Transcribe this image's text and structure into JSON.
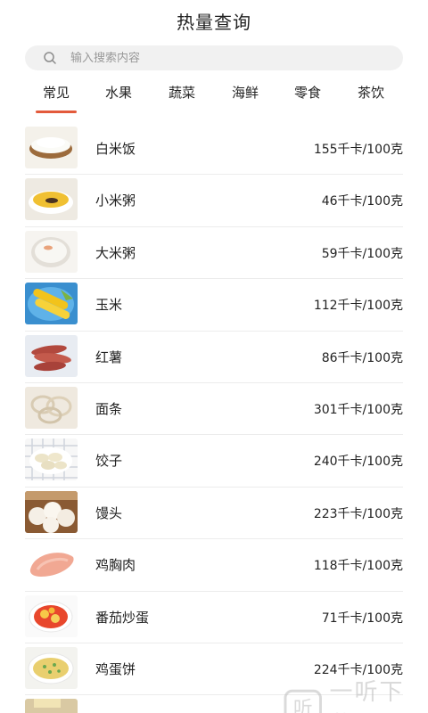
{
  "header": {
    "title": "热量查询"
  },
  "search": {
    "placeholder": "输入搜索内容",
    "value": ""
  },
  "tabs": [
    {
      "label": "常见",
      "active": true
    },
    {
      "label": "水果",
      "active": false
    },
    {
      "label": "蔬菜",
      "active": false
    },
    {
      "label": "海鲜",
      "active": false
    },
    {
      "label": "零食",
      "active": false
    },
    {
      "label": "茶饮",
      "active": false
    }
  ],
  "foods": [
    {
      "name": "白米饭",
      "kcal": "155千卡/100克",
      "image": "rice-bowl"
    },
    {
      "name": "小米粥",
      "kcal": "46千卡/100克",
      "image": "millet-porridge"
    },
    {
      "name": "大米粥",
      "kcal": "59千卡/100克",
      "image": "rice-porridge"
    },
    {
      "name": "玉米",
      "kcal": "112千卡/100克",
      "image": "corn"
    },
    {
      "name": "红薯",
      "kcal": "86千卡/100克",
      "image": "sweet-potato"
    },
    {
      "name": "面条",
      "kcal": "301千卡/100克",
      "image": "noodles"
    },
    {
      "name": "饺子",
      "kcal": "240千卡/100克",
      "image": "dumplings"
    },
    {
      "name": "馒头",
      "kcal": "223千卡/100克",
      "image": "steamed-buns"
    },
    {
      "name": "鸡胸肉",
      "kcal": "118千卡/100克",
      "image": "chicken-breast"
    },
    {
      "name": "番茄炒蛋",
      "kcal": "71千卡/100克",
      "image": "tomato-egg"
    },
    {
      "name": "鸡蛋饼",
      "kcal": "224千卡/100克",
      "image": "egg-pancake"
    }
  ],
  "watermark": {
    "text": "一听下载",
    "logo_glyph": "听"
  },
  "colors": {
    "accent": "#e35a3b",
    "divider": "#ececec",
    "search_bg": "#f1f1f1"
  }
}
